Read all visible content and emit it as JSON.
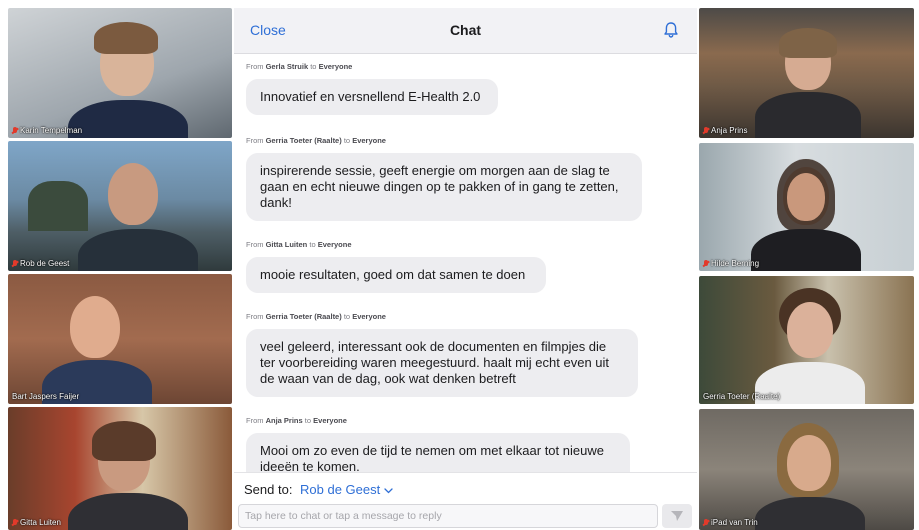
{
  "chat": {
    "close_label": "Close",
    "title": "Chat",
    "messages": [
      {
        "from_prefix": "From",
        "sender": "Gerla Struik",
        "to_word": "to",
        "recipient": "Everyone",
        "text": "Innovatief en versnellend E-Health 2.0"
      },
      {
        "from_prefix": "From",
        "sender": "Gerria Toeter (Raalte)",
        "to_word": "to",
        "recipient": "Everyone",
        "text": "inspirerende sessie, geeft energie om morgen aan de slag te gaan en echt nieuwe dingen op te pakken of in gang te zetten, dank!"
      },
      {
        "from_prefix": "From",
        "sender": "Gitta Luiten",
        "to_word": "to",
        "recipient": "Everyone",
        "text": "mooie resultaten, goed om dat samen te doen"
      },
      {
        "from_prefix": "From",
        "sender": "Gerria Toeter (Raalte)",
        "to_word": "to",
        "recipient": "Everyone",
        "text": "veel geleerd, interessant ook de documenten en filmpjes die ter voorbereiding waren meegestuurd. haalt mij echt even uit de waan van de dag, ook wat denken betreft"
      },
      {
        "from_prefix": "From",
        "sender": "Anja Prins",
        "to_word": "to",
        "recipient": "Everyone",
        "text": "Mooi om zo even de tijd te nemen om met elkaar tot nieuwe ideeën te komen."
      }
    ],
    "send_to_label": "Send to:",
    "send_to_value": "Rob de Geest",
    "input_placeholder": "Tap here to chat or tap a message to reply"
  },
  "participants_left": [
    {
      "name": "Karin Tempelman",
      "muted": true
    },
    {
      "name": "Rob de Geest",
      "muted": true
    },
    {
      "name": "Bart Jaspers Faijer",
      "muted": false
    },
    {
      "name": "Gitta Luiten",
      "muted": true
    }
  ],
  "participants_right": [
    {
      "name": "Anja Prins",
      "muted": true
    },
    {
      "name": "Hilde Berning",
      "muted": true
    },
    {
      "name": "Gerria Toeter (Raalte)",
      "muted": false
    },
    {
      "name": "iPad van Trin",
      "muted": true
    }
  ],
  "colors": {
    "accent": "#2f6fd6",
    "muted_mic": "#e23a2b",
    "bubble": "#ededf0"
  },
  "icons": {
    "bell": "bell-icon",
    "send": "send-icon",
    "chevron": "chevron-down-icon",
    "mic_muted": "mic-muted-icon"
  }
}
